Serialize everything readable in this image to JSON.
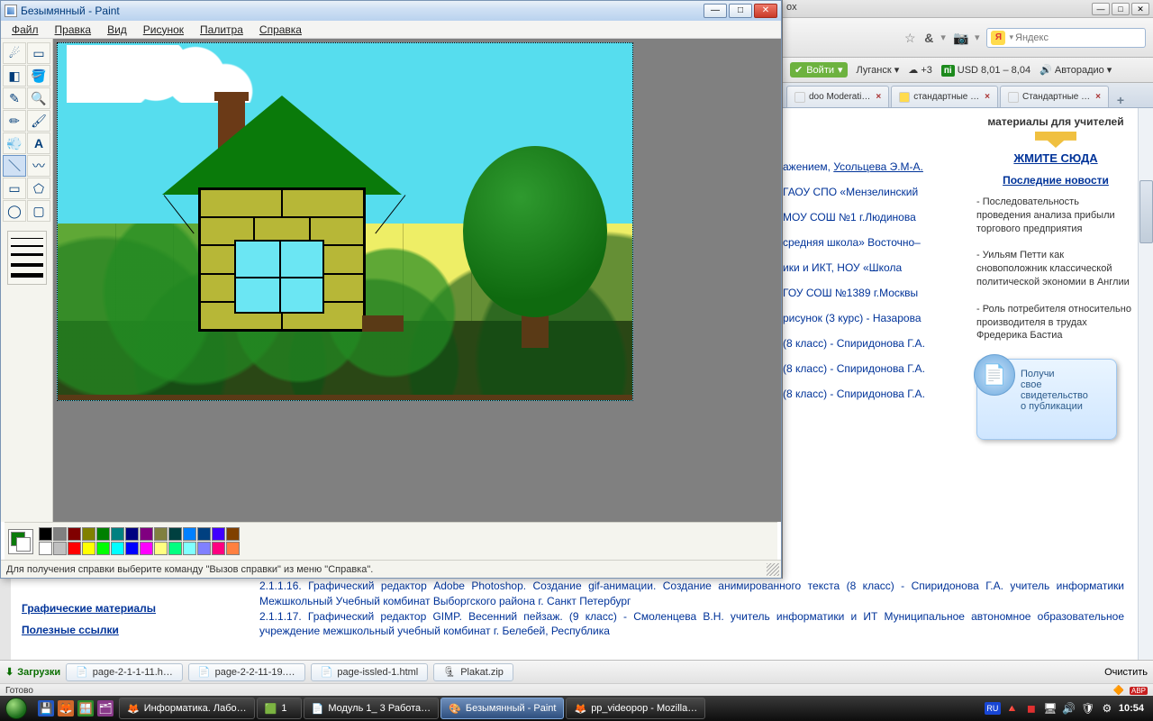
{
  "paint": {
    "title": "Безымянный - Paint",
    "menu": [
      "Файл",
      "Правка",
      "Вид",
      "Рисунок",
      "Палитра",
      "Справка"
    ],
    "status": "Для получения справки выберите команду \"Вызов справки\" из меню \"Справка\".",
    "palette_row1": [
      "#000000",
      "#808080",
      "#800000",
      "#808000",
      "#008000",
      "#008080",
      "#000080",
      "#800080",
      "#808040",
      "#004040",
      "#0080ff",
      "#004080",
      "#4000ff",
      "#804000"
    ],
    "palette_row2": [
      "#ffffff",
      "#c0c0c0",
      "#ff0000",
      "#ffff00",
      "#00ff00",
      "#00ffff",
      "#0000ff",
      "#ff00ff",
      "#ffff80",
      "#00ff80",
      "#80ffff",
      "#8080ff",
      "#ff0080",
      "#ff8040"
    ],
    "current_fg": "#0a7a0a",
    "current_bg": "#ffffff"
  },
  "firefox": {
    "title_fragment": "ox",
    "search_placeholder": "Яндекс",
    "band": {
      "login": "Войти",
      "city": "Луганск",
      "weather": "+3",
      "usd": "USD 8,01 – 8,04",
      "radio": "Авторадио"
    },
    "tabs": [
      {
        "label": "doo Moderati…"
      },
      {
        "label": "стандартные …"
      },
      {
        "label": "Стандартные …"
      }
    ],
    "greeting_tail": "ажением,",
    "greeting_link": "Усольцева Э.М-А.",
    "left_fragments": [
      "ГАОУ СПО «Мензелинский",
      "МОУ СОШ №1 г.Людинова",
      "средняя школа» Восточно–",
      "ики и ИКТ, НОУ «Школа",
      "ГОУ СОШ №1389 г.Москвы",
      "рисунок (3 курс) - Назарова",
      "(8 класс) - Спиридонова Г.А.",
      "(8 класс) - Спиридонова Г.А.",
      "(8 класс) - Спиридонова Г.А."
    ],
    "right": {
      "heading1": "материалы для учителей",
      "cta": "ЖМИТЕ СЮДА",
      "heading2": "Последние новости",
      "news": [
        "- Последовательность проведения анализа прибыли торгового предприятия",
        "- Уильям Петти как сновоположник классической политической экономии в Англии",
        "- Роль потребителя относительно производителя в трудах Фредерика Бастиа"
      ],
      "badge_l1": "Получи",
      "badge_l2": "свое свидетельство",
      "badge_l3": "о публикации"
    },
    "below": {
      "links": [
        "Графические материалы",
        "Полезные ссылки"
      ],
      "p1": "2.1.1.16. Графический редактор Adobe Photoshop. Создание gif-анимации. Создание анимированного текста (8 класс) - Спиридонова Г.А. учитель информатики Межшкольный Учебный комбинат Выборгского района г. Санкт Петербург",
      "p2": "2.1.1.17. Графический редактор GIMP. Весенний пейзаж. (9 класс) - Смоленцева В.Н. учитель информатики и ИТ Муниципальное автономное образовательное учреждение межшкольный учебный комбинат г. Белебей, Республика"
    },
    "downloads": {
      "label": "Загрузки",
      "items": [
        "page-2-1-1-11.h…",
        "page-2-2-11-19.…",
        "page-issled-1.html",
        "Plakat.zip"
      ],
      "clear": "Очистить"
    },
    "status2": "Готово"
  },
  "taskbar": {
    "tasks": [
      {
        "label": "Информатика. Лабо…"
      },
      {
        "label": "1"
      },
      {
        "label": "Модуль 1_ 3 Работа…"
      },
      {
        "label": "Безымянный - Paint",
        "active": true
      },
      {
        "label": "pp_videopop - Mozilla…"
      }
    ],
    "lang": "RU",
    "clock": "10:54"
  }
}
